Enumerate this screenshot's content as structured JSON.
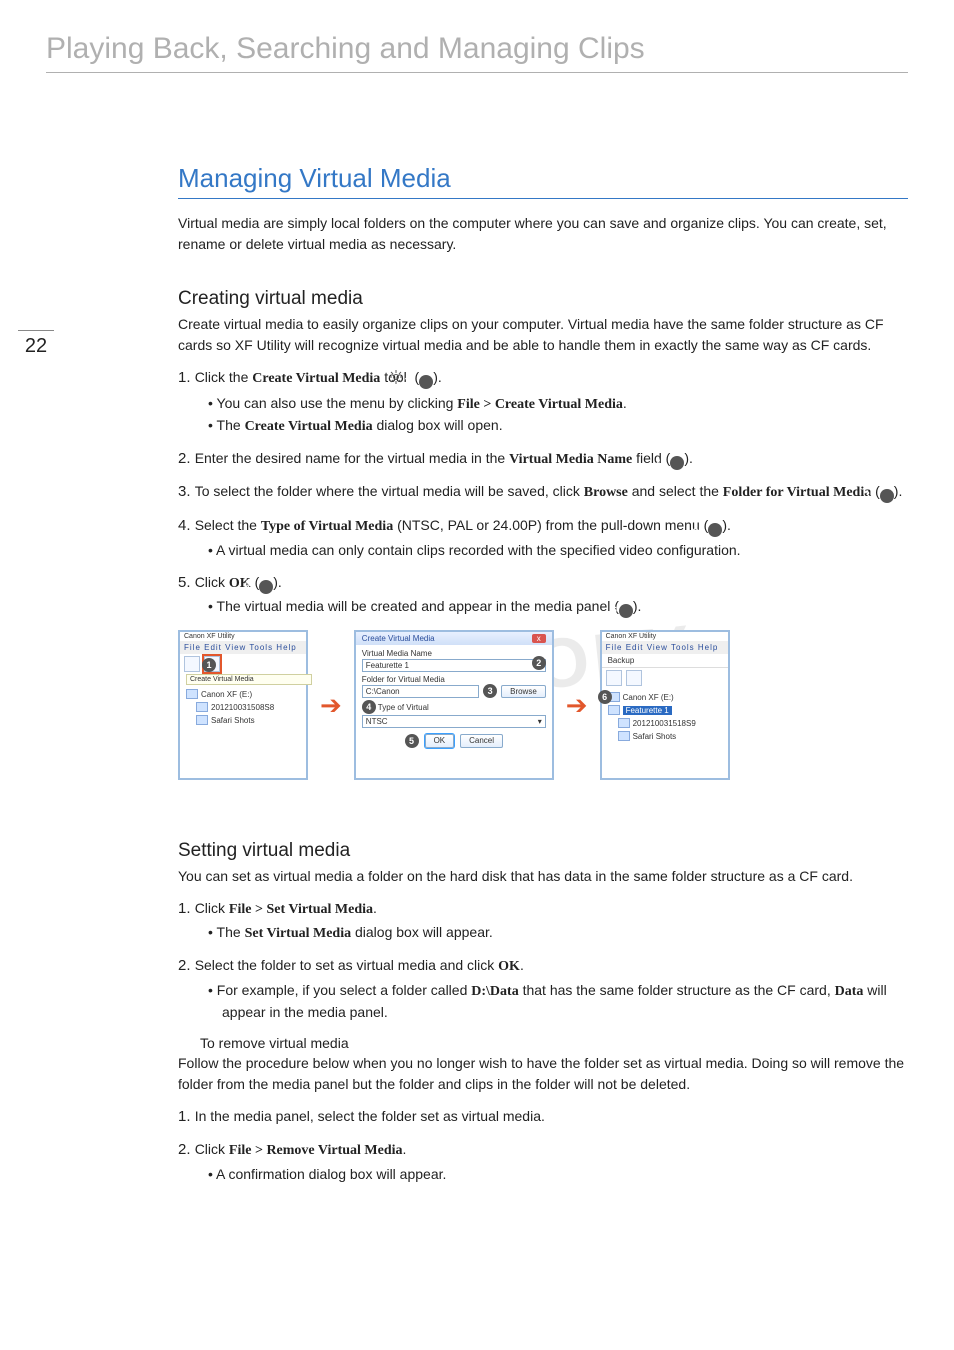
{
  "page_number": "22",
  "chapter_title": "Playing Back, Searching and Managing Clips",
  "watermark": "COPY",
  "h2": "Managing Virtual Media",
  "intro": "Virtual media are simply local folders on the computer where you can save and organize clips. You can create, set, rename or delete virtual media as necessary.",
  "sec_create": {
    "h3": "Creating virtual media",
    "para": "Create virtual media to easily organize clips on your computer. Virtual media have the same folder structure as CF cards so XF Utility will recognize virtual media and be able to handle them in exactly the same way as CF cards.",
    "steps": {
      "s1_pre": "Click the ",
      "s1_tool": "Create Virtual Media",
      "s1_post": " tool ",
      "s1_circ": "1",
      "s1_b1_pre": "You can also use the menu by clicking ",
      "s1_b1_bold": "File > Create Virtual Media",
      "s1_b2_pre": "The ",
      "s1_b2_bold": "Create Virtual Media",
      "s1_b2_post": " dialog box will open.",
      "s2_pre": "Enter the desired name for the virtual media in the ",
      "s2_bold": "Virtual Media Name",
      "s2_post": " field (",
      "s2_circ": "2",
      "s3_pre": "To select the folder where the virtual media will be saved, click ",
      "s3_bold1": "Browse",
      "s3_mid": " and select the ",
      "s3_bold2": "Folder for Virtual Media",
      "s3_post": " (",
      "s3_circ": "3",
      "s4_pre": "Select the ",
      "s4_bold": "Type of Virtual Media",
      "s4_post": " (NTSC, PAL or 24.00P) from the pull-down menu (",
      "s4_circ": "4",
      "s4_b1": "A virtual media can only contain clips recorded with the specified video configuration.",
      "s5_pre": "Click ",
      "s5_bold": "OK",
      "s5_post": " (",
      "s5_circ": "5",
      "s5_b1_pre": "The virtual media will be created and appear in the media panel (",
      "s5_b1_circ": "6"
    }
  },
  "figure": {
    "circ1": "1",
    "circ2": "2",
    "circ3": "3",
    "circ4": "4",
    "circ5": "5",
    "circ6": "6",
    "panel_left": {
      "title": "Canon XF Utility",
      "menu": "File  Edit  View  Tools  Help",
      "tooltip": "Create Virtual Media",
      "tree": [
        "Canon XF (E:)",
        "201210031508S8",
        "Safari Shots"
      ]
    },
    "dialog": {
      "title": "Create Virtual Media",
      "lbl1": "Virtual Media Name",
      "val1": "Featurette 1",
      "lbl2": "Folder for Virtual Media",
      "val2": "C:\\Canon",
      "browse": "Browse",
      "lbl3": "Type of Virtual",
      "val3": "NTSC",
      "ok": "OK",
      "cancel": "Cancel"
    },
    "panel_right": {
      "title": "Canon XF Utility",
      "menu": "File  Edit  View  Tools  Help",
      "backup": "Backup",
      "tree": [
        "Canon XF (E:)",
        "Featurette 1",
        "201210031518S9",
        "Safari Shots"
      ]
    }
  },
  "sec_set": {
    "h3": "Setting virtual media",
    "para": "You can set as virtual media a folder on the hard disk that has data in the same folder structure as a CF card.",
    "s1_pre": "Click ",
    "s1_bold": "File > Set Virtual Media",
    "s1_b1_pre": "The ",
    "s1_b1_bold": "Set Virtual Media",
    "s1_b1_post": " dialog box will appear.",
    "s2_pre": "Select the folder to set as virtual media and click ",
    "s2_bold": "OK",
    "s2_b1_pre": "For example, if you select a folder called ",
    "s2_b1_bold1": "D:\\Data",
    "s2_b1_mid": " that has the same folder structure as the CF card, ",
    "s2_b1_bold2": "Data",
    "s2_b1_post": " will appear in the media panel.",
    "remove_h": "To remove virtual media",
    "remove_p": "Follow the procedure below when you no longer wish to have the folder set as virtual media. Doing so will remove the folder from the media panel but the folder and clips in the folder will not be deleted.",
    "r1": "In the media panel, select the folder set as virtual media.",
    "r2_pre": "Click ",
    "r2_bold": "File > Remove Virtual Media",
    "r2_b1": "A confirmation dialog box will appear."
  }
}
